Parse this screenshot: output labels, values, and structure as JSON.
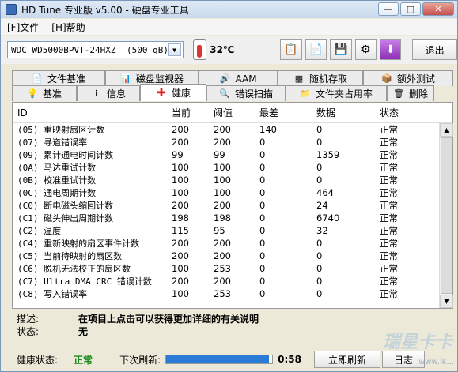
{
  "window": {
    "title": "HD Tune 专业版 v5.00 - 硬盘专业工具"
  },
  "menu": [
    {
      "label": "[F]文件"
    },
    {
      "label": "[H]帮助"
    }
  ],
  "toolbar": {
    "drive": {
      "name": "WDC WD5000BPVT-24HXZ",
      "size": "(500 gB)"
    },
    "temperature": "32℃",
    "exit_label": "退出"
  },
  "tabs_top": [
    {
      "label": "文件基准",
      "icon": "file-benchmark-icon"
    },
    {
      "label": "磁盘监视器",
      "icon": "disk-monitor-icon"
    },
    {
      "label": "AAM",
      "icon": "speaker-icon"
    },
    {
      "label": "随机存取",
      "icon": "random-access-icon"
    },
    {
      "label": "额外测试",
      "icon": "extra-tests-icon"
    }
  ],
  "tabs_bottom": [
    {
      "label": "基准",
      "icon": "benchmark-icon"
    },
    {
      "label": "信息",
      "icon": "info-icon"
    },
    {
      "label": "健康",
      "icon": "health-cross-icon",
      "active": true
    },
    {
      "label": "错误扫描",
      "icon": "error-scan-icon"
    },
    {
      "label": "文件夹占用率",
      "icon": "folder-usage-icon"
    },
    {
      "label": "删除",
      "icon": "erase-icon"
    }
  ],
  "table": {
    "headers": [
      "ID",
      "当前",
      "阈值",
      "最差",
      "数据",
      "状态"
    ],
    "rows": [
      [
        "(05) 重映射扇区计数",
        "200",
        "200",
        "140",
        "0",
        "正常"
      ],
      [
        "(07) 寻道错误率",
        "200",
        "200",
        "0",
        "0",
        "正常"
      ],
      [
        "(09) 累计通电时间计数",
        "99",
        "99",
        "0",
        "1359",
        "正常"
      ],
      [
        "(0A) 马达重试计数",
        "100",
        "100",
        "0",
        "0",
        "正常"
      ],
      [
        "(0B) 校准重试计数",
        "100",
        "100",
        "0",
        "0",
        "正常"
      ],
      [
        "(0C) 通电周期计数",
        "100",
        "100",
        "0",
        "464",
        "正常"
      ],
      [
        "(C0) 断电磁头缩回计数",
        "200",
        "200",
        "0",
        "24",
        "正常"
      ],
      [
        "(C1) 磁头伸出周期计数",
        "198",
        "198",
        "0",
        "6740",
        "正常"
      ],
      [
        "(C2) 温度",
        "115",
        "95",
        "0",
        "32",
        "正常"
      ],
      [
        "(C4) 重新映射的扇区事件计数",
        "200",
        "200",
        "0",
        "0",
        "正常"
      ],
      [
        "(C5) 当前待映射的扇区数",
        "200",
        "200",
        "0",
        "0",
        "正常"
      ],
      [
        "(C6) 脱机无法校正的扇区数",
        "100",
        "253",
        "0",
        "0",
        "正常"
      ],
      [
        "(C7) Ultra DMA CRC 错误计数",
        "200",
        "200",
        "0",
        "0",
        "正常"
      ],
      [
        "(C8) 写入错误率",
        "100",
        "253",
        "0",
        "0",
        "正常"
      ]
    ]
  },
  "status": {
    "description_label": "描述:",
    "description_value": "在项目上点击可以获得更加详细的有关说明",
    "state_label": "状态:",
    "state_value": "无"
  },
  "footer": {
    "health_label": "健康状态:",
    "health_value": "正常",
    "refresh_label": "下次刷新:",
    "progress": 0.97,
    "countdown": "0:58",
    "refresh_button": "立即刷新",
    "log_button": "日志"
  },
  "watermark": {
    "text": "瑞星卡卡",
    "sub": "www.ik..."
  },
  "colors": {
    "health_ok": "#1a8b1a",
    "accent": "#2a7bd5"
  }
}
